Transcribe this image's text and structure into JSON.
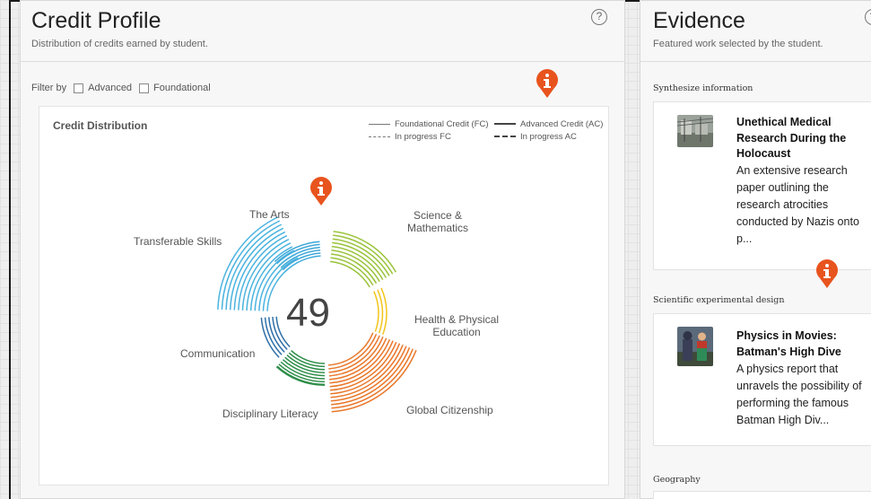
{
  "colors": {
    "accent_orange": "#e8541e",
    "arts": "#3ea7d8",
    "science": "#9ac33a",
    "health": "#f2c51a",
    "global": "#e9772a",
    "disciplinary": "#2f8e4a",
    "communication": "#2e6fa7",
    "transferable": "#4ab3df"
  },
  "credit_profile": {
    "title": "Credit Profile",
    "subtitle": "Distribution of credits earned by student.",
    "help_icon": "?",
    "filter": {
      "label": "Filter by",
      "options": [
        "Advanced",
        "Foundational"
      ]
    },
    "chart": {
      "title": "Credit Distribution",
      "legend": [
        {
          "label": "Foundational Credit (FC)",
          "style": "thin-solid"
        },
        {
          "label": "Advanced Credit (AC)",
          "style": "thick-solid"
        },
        {
          "label": "In progress FC",
          "style": "thin-dashed"
        },
        {
          "label": "In progress AC",
          "style": "thick-dashed"
        }
      ],
      "total": "49",
      "categories": [
        {
          "label": "The Arts"
        },
        {
          "label": "Science & Mathematics"
        },
        {
          "label": "Health & Physical Education"
        },
        {
          "label": "Global Citizenship"
        },
        {
          "label": "Disciplinary Literacy"
        },
        {
          "label": "Communication"
        },
        {
          "label": "Transferable Skills"
        }
      ]
    }
  },
  "evidence": {
    "title": "Evidence",
    "subtitle": "Featured work selected by the student.",
    "help_icon": "?",
    "sections": [
      {
        "heading": "Synthesize information",
        "item": {
          "title_lines": [
            "Unethical Medical",
            "Research During the",
            "Holocaust"
          ],
          "desc_lines": [
            "An extensive research",
            "paper outlining the",
            "research atrocities",
            "conducted by Nazis onto",
            "p..."
          ],
          "thumb_icon": "camp-photo-icon"
        }
      },
      {
        "heading": "Scientific experimental design",
        "item": {
          "title_lines": [
            "Physics in Movies:",
            "Batman's High Dive"
          ],
          "desc_lines": [
            "A physics report that",
            "unravels the possibility of",
            "performing the famous",
            "Batman High Div..."
          ],
          "thumb_icon": "batman-photo-icon"
        }
      },
      {
        "heading": "Geography"
      }
    ]
  }
}
